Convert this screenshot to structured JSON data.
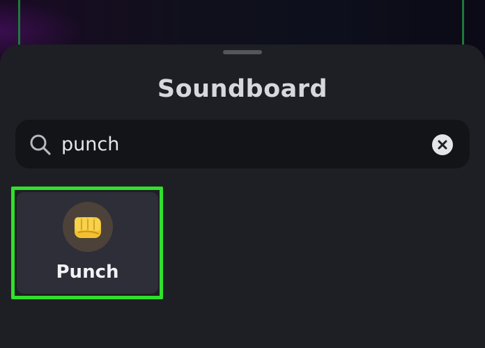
{
  "soundboard": {
    "title": "Soundboard"
  },
  "search": {
    "value": "punch",
    "icon": "search-icon"
  },
  "clear": {
    "icon": "close-icon"
  },
  "results": [
    {
      "label": "Punch",
      "icon": "fist-icon"
    }
  ],
  "colors": {
    "sheet_bg": "#1e1f24",
    "search_bg": "#131418",
    "tile_bg": "#2d2e38",
    "highlight": "#31e02c",
    "emoji_bg": "#4c423a",
    "fist": "#f2c12e"
  }
}
